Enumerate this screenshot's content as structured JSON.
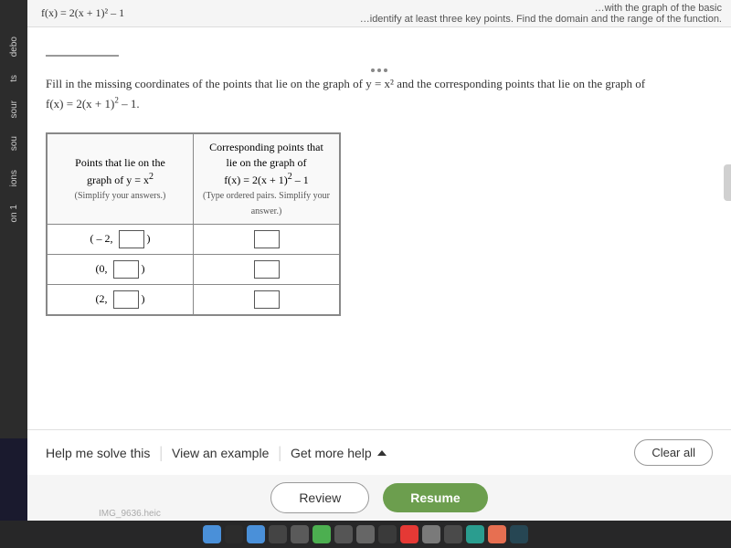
{
  "header": {
    "formula": "f(x) = 2(x + 1)² – 1",
    "right_text": "…identify at least three key points. Find the domain and the range of the function.",
    "right_text2": "…with the graph of the basic"
  },
  "sidebar": {
    "labels": [
      "sour",
      "sou",
      "ions",
      "on 1",
      "ts",
      "debo"
    ]
  },
  "question": {
    "intro": "Fill in the missing coordinates of the points that lie on the graph of y = x² and the corresponding points that lie on the graph of",
    "formula": "f(x) = 2(x + 1)² – 1.",
    "instruction": "(Simplify your answers.)"
  },
  "table": {
    "col1_header": "Points that lie on the graph of y = x²",
    "col1_sub": "(Simplify your answers.)",
    "col2_header": "Corresponding points that lie on the graph of",
    "col2_formula": "f(x) = 2(x + 1)² – 1",
    "col2_sub": "(Type ordered pairs. Simplify your answer.)",
    "rows": [
      {
        "point": "(–2,",
        "box_val": ")"
      },
      {
        "point": "(0,",
        "box_val": ")"
      },
      {
        "point": "(2,",
        "box_val": ")"
      }
    ]
  },
  "actions": {
    "help_label": "Help me solve this",
    "example_label": "View an example",
    "more_help_label": "Get more help",
    "clear_all_label": "Clear all"
  },
  "bottom_nav": {
    "review_label": "Review",
    "resume_label": "Resume"
  },
  "dock": {
    "filename": "IMG_9636.heic"
  }
}
